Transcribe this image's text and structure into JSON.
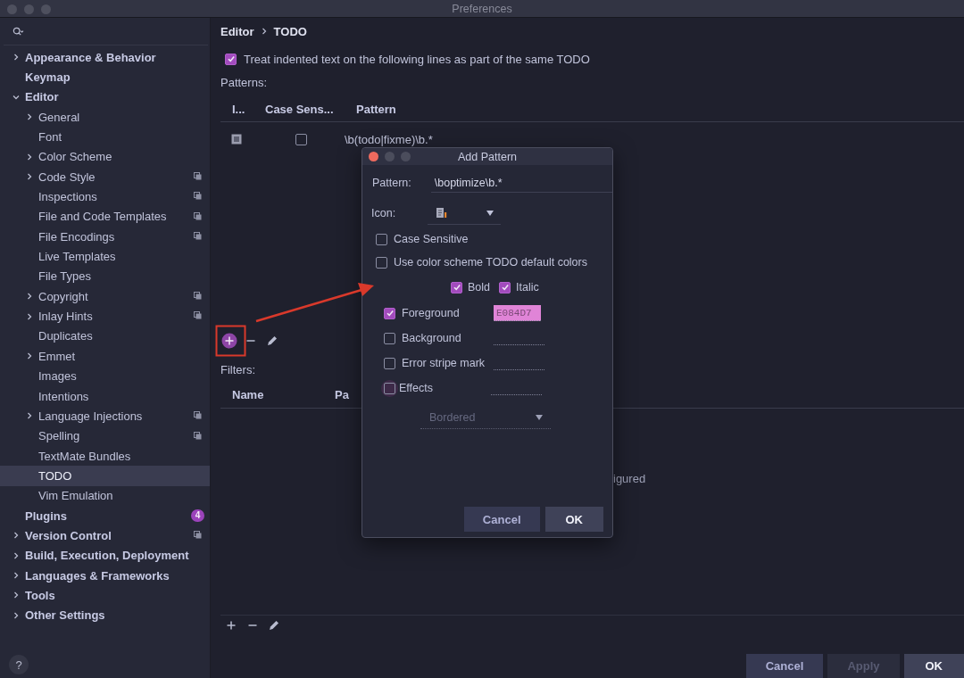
{
  "window": {
    "title": "Preferences"
  },
  "sidebar": {
    "items": [
      {
        "label": "Appearance & Behavior",
        "expanded": false,
        "selected": false,
        "project_scope": false
      },
      {
        "label": "Keymap",
        "selected": false,
        "project_scope": false
      },
      {
        "label": "Editor",
        "expanded": true,
        "selected": false,
        "project_scope": false,
        "children": [
          {
            "label": "General",
            "expanded": false,
            "selected": false,
            "project_scope": false
          },
          {
            "label": "Font",
            "selected": false,
            "project_scope": false
          },
          {
            "label": "Color Scheme",
            "expanded": false,
            "selected": false,
            "project_scope": false
          },
          {
            "label": "Code Style",
            "expanded": false,
            "selected": false,
            "project_scope": true
          },
          {
            "label": "Inspections",
            "selected": false,
            "project_scope": true
          },
          {
            "label": "File and Code Templates",
            "selected": false,
            "project_scope": true
          },
          {
            "label": "File Encodings",
            "selected": false,
            "project_scope": true
          },
          {
            "label": "Live Templates",
            "selected": false,
            "project_scope": false
          },
          {
            "label": "File Types",
            "selected": false,
            "project_scope": false
          },
          {
            "label": "Copyright",
            "expanded": false,
            "selected": false,
            "project_scope": true
          },
          {
            "label": "Inlay Hints",
            "expanded": false,
            "selected": false,
            "project_scope": true
          },
          {
            "label": "Duplicates",
            "selected": false,
            "project_scope": false
          },
          {
            "label": "Emmet",
            "expanded": false,
            "selected": false,
            "project_scope": false
          },
          {
            "label": "Images",
            "selected": false,
            "project_scope": false
          },
          {
            "label": "Intentions",
            "selected": false,
            "project_scope": false
          },
          {
            "label": "Language Injections",
            "expanded": false,
            "selected": false,
            "project_scope": true
          },
          {
            "label": "Spelling",
            "selected": false,
            "project_scope": true
          },
          {
            "label": "TextMate Bundles",
            "selected": false,
            "project_scope": false
          },
          {
            "label": "TODO",
            "selected": true,
            "project_scope": false
          },
          {
            "label": "Vim Emulation",
            "selected": false,
            "project_scope": false
          }
        ]
      },
      {
        "label": "Plugins",
        "selected": false,
        "project_scope": false,
        "badge": "4"
      },
      {
        "label": "Version Control",
        "expanded": false,
        "selected": false,
        "project_scope": true
      },
      {
        "label": "Build, Execution, Deployment",
        "expanded": false,
        "selected": false,
        "project_scope": false
      },
      {
        "label": "Languages & Frameworks",
        "expanded": false,
        "selected": false,
        "project_scope": false
      },
      {
        "label": "Tools",
        "expanded": false,
        "selected": false,
        "project_scope": false
      },
      {
        "label": "Other Settings",
        "expanded": false,
        "selected": false,
        "project_scope": false
      }
    ],
    "help_button": "?"
  },
  "main": {
    "breadcrumb": [
      "Editor",
      "TODO"
    ],
    "options": [
      {
        "label": "Treat indented text on the following lines as part of the same TODO",
        "checked": true
      }
    ],
    "patterns": {
      "label": "Patterns:",
      "columns": [
        "I...",
        "Case Sens...",
        "Pattern"
      ],
      "rows": [
        {
          "case_sensitive": false,
          "pattern": "\\b(todo|fixme)\\b.*"
        }
      ],
      "toolbar": [
        {
          "kind": "add",
          "focused": true
        },
        {
          "kind": "remove",
          "focused": false
        },
        {
          "kind": "edit",
          "focused": false
        }
      ]
    },
    "filters": {
      "label": "Filters:",
      "columns": [
        "Name",
        "Pa"
      ],
      "empty_text": "igured",
      "toolbar": [
        {
          "kind": "add",
          "focused": false
        },
        {
          "kind": "remove",
          "focused": false
        },
        {
          "kind": "edit",
          "focused": false
        }
      ]
    },
    "buttons": [
      {
        "label": "Cancel",
        "disabled": false,
        "default": false
      },
      {
        "label": "Apply",
        "disabled": true,
        "default": false
      },
      {
        "label": "OK",
        "disabled": false,
        "default": true
      }
    ]
  },
  "dialog": {
    "title": "Add Pattern",
    "pattern": {
      "label": "Pattern:",
      "value": "\\boptimize\\b.*"
    },
    "icon": {
      "label": "Icon:"
    },
    "options": [
      {
        "label": "Case Sensitive",
        "checked": false
      },
      {
        "label": "Use color scheme TODO default colors",
        "checked": false
      }
    ],
    "font_styles": [
      {
        "label": "Bold",
        "checked": true
      },
      {
        "label": "Italic",
        "checked": true
      }
    ],
    "attributes": [
      {
        "label": "Foreground",
        "checked": true,
        "focused": false,
        "value": "E084D7",
        "color": "#e084d7"
      },
      {
        "label": "Background",
        "checked": false,
        "focused": false
      },
      {
        "label": "Error stripe mark",
        "checked": false,
        "focused": false
      },
      {
        "label": "Effects",
        "checked": false,
        "focused": true
      }
    ],
    "effect_type": {
      "value": "Bordered",
      "disabled": true
    },
    "buttons": [
      {
        "label": "Cancel",
        "default": false
      },
      {
        "label": "OK",
        "default": true
      }
    ]
  }
}
